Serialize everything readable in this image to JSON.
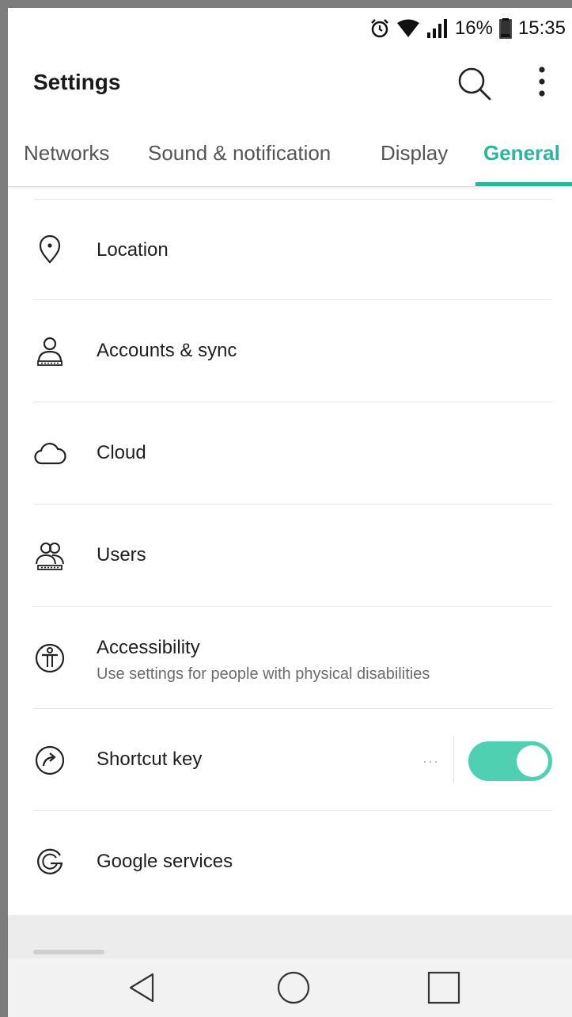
{
  "status_bar": {
    "battery_percent": "16%",
    "time": "15:35",
    "icons": [
      "alarm-icon",
      "wifi-icon",
      "signal-icon",
      "battery-icon"
    ]
  },
  "app_bar": {
    "title": "Settings",
    "icons": [
      "search-icon",
      "more-vert-icon"
    ]
  },
  "tabs": [
    {
      "label": "Networks",
      "active": false
    },
    {
      "label": "Sound & notification",
      "active": false
    },
    {
      "label": "Display",
      "active": false
    },
    {
      "label": "General",
      "active": true
    }
  ],
  "accent_color": "#2bb59a",
  "toggle_color": "#4fd0b0",
  "items": [
    {
      "label": "Location",
      "icon": "location-pin-icon"
    },
    {
      "label": "Accounts & sync",
      "icon": "account-icon"
    },
    {
      "label": "Cloud",
      "icon": "cloud-icon"
    },
    {
      "label": "Users",
      "icon": "users-icon"
    },
    {
      "label": "Accessibility",
      "sub": "Use settings for people with physical disabilities",
      "icon": "accessibility-icon"
    },
    {
      "label": "Shortcut key",
      "icon": "shortcut-icon",
      "toggle_on": true,
      "more_label": "···"
    },
    {
      "label": "Google services",
      "icon": "google-icon"
    }
  ],
  "nav_bar": {
    "icons": [
      "back-icon",
      "home-icon",
      "recents-icon"
    ]
  }
}
